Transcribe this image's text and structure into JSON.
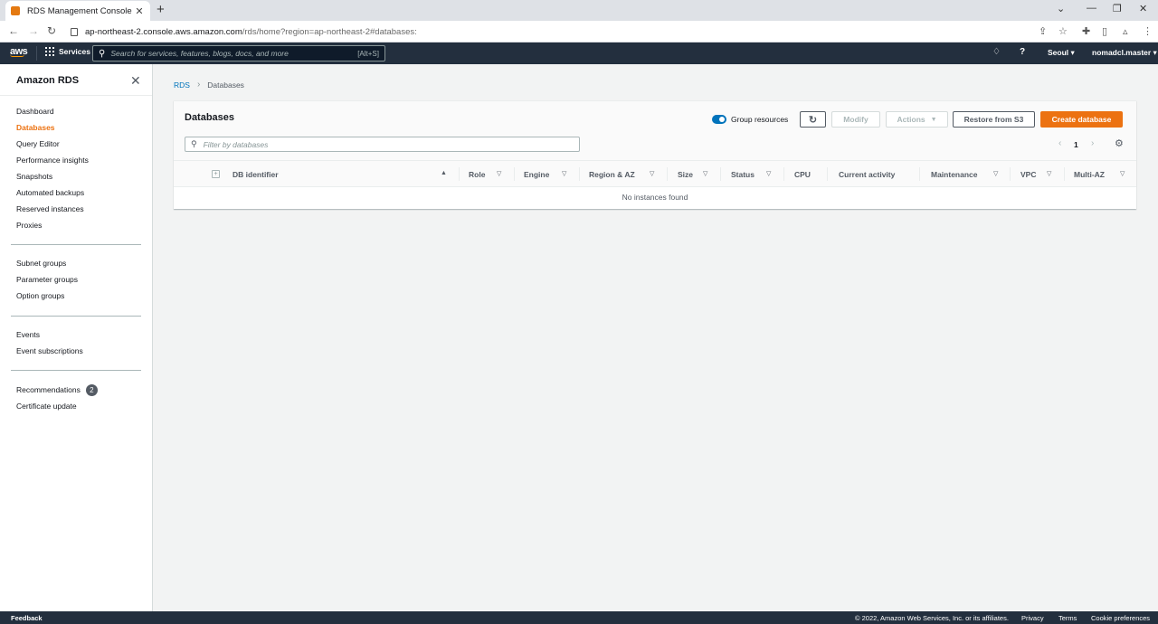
{
  "browser": {
    "tab_title": "RDS Management Console",
    "url_host": "ap-northeast-2.console.aws.amazon.com",
    "url_path": "/rds/home?region=ap-northeast-2#databases:"
  },
  "topnav": {
    "logo": "aws",
    "services_label": "Services",
    "search_placeholder": "Search for services, features, blogs, docs, and more",
    "search_hint": "[Alt+S]",
    "region": "Seoul ▾",
    "account": "nomadcl.master ▾"
  },
  "sidebar": {
    "title": "Amazon RDS",
    "group1": [
      "Dashboard",
      "Databases",
      "Query Editor",
      "Performance insights",
      "Snapshots",
      "Automated backups",
      "Reserved instances",
      "Proxies"
    ],
    "group2": [
      "Subnet groups",
      "Parameter groups",
      "Option groups"
    ],
    "group3": [
      "Events",
      "Event subscriptions"
    ],
    "group4": [
      "Recommendations",
      "Certificate update"
    ],
    "recommendations_count": "2",
    "active": "Databases"
  },
  "breadcrumb": {
    "root": "RDS",
    "current": "Databases"
  },
  "panel": {
    "title": "Databases",
    "group_resources_label": "Group resources",
    "modify_label": "Modify",
    "actions_label": "Actions",
    "restore_label": "Restore from S3",
    "create_label": "Create database",
    "filter_placeholder": "Filter by databases",
    "page": "1",
    "empty_text": "No instances found"
  },
  "table": {
    "columns": [
      "DB identifier",
      "Role",
      "Engine",
      "Region & AZ",
      "Size",
      "Status",
      "CPU",
      "Current activity",
      "Maintenance",
      "VPC",
      "Multi-AZ"
    ]
  },
  "footer": {
    "feedback": "Feedback",
    "copyright": "© 2022, Amazon Web Services, Inc. or its affiliates.",
    "privacy": "Privacy",
    "terms": "Terms",
    "cookies": "Cookie preferences"
  },
  "colors": {
    "aws_nav": "#232f3e",
    "accent_orange": "#ec7211",
    "link_blue": "#0073bb"
  }
}
